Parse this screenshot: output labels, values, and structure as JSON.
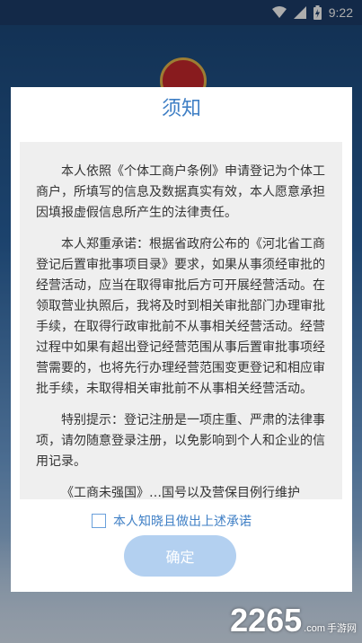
{
  "status_bar": {
    "time": "9:22",
    "icons": [
      "wifi-icon",
      "signal-icon",
      "battery-icon"
    ]
  },
  "dialog": {
    "title": "须知",
    "paragraphs": [
      "本人依照《个体工商户条例》申请登记为个体工商户，所填写的信息及数据真实有效，本人愿意承担因填报虚假信息所产生的法律责任。",
      "本人郑重承诺：根据省政府公布的《河北省工商登记后置审批事项目录》要求，如果从事须经审批的经营活动，应当在取得审批后方可开展经营活动。在领取营业执照后，我将及时到相关审批部门办理审批手续，在取得行政审批前不从事相关经营活动。经营过程中如果有超出登记经营范围从事后置审批事项经营需要的，也将先行办理经营范围变更登记和相应审批手续，未取得相关审批前不从事相关经营活动。",
      "特别提示：登记注册是一项庄重、严肃的法律事项，请勿随意登录注册，以免影响到个人和企业的信用记录。",
      "《工商未强国》…国号以及营保目例行维护"
    ],
    "agree_label": "本人知晓且做出上述承诺",
    "agree_checked": false,
    "confirm_label": "确定"
  },
  "watermark": {
    "number": "2265",
    "suffix": ".com",
    "site": "手游网"
  },
  "colors": {
    "accent": "#3f7fc5",
    "button_disabled": "#b3d0f0",
    "content_bg": "#efefef"
  }
}
